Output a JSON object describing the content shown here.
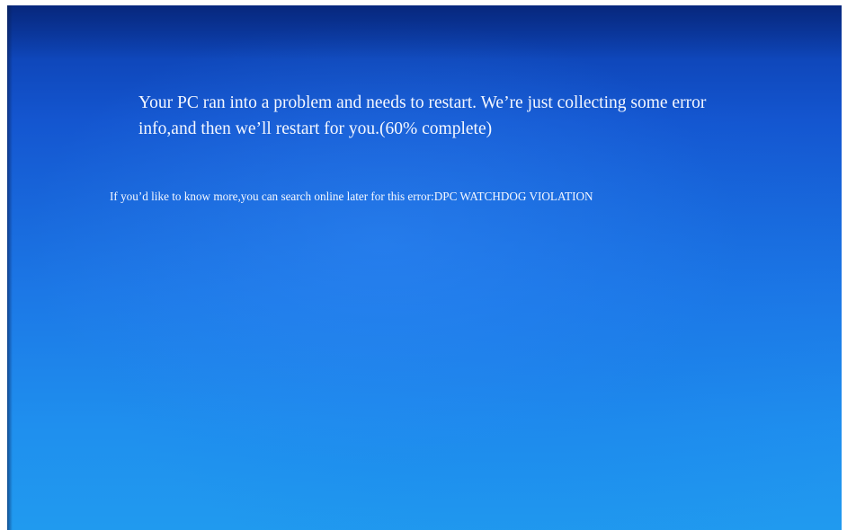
{
  "error_screen": {
    "message_line_1": "Your PC ran into a problem and needs to restart. We’re just collecting some error",
    "message_line_2": "info,and then we’ll restart for you.(60% complete)",
    "progress_percent": 60,
    "more_info": "If you’d like to know more,you can search online later for this error:DPC WATCHDOG VIOLATION",
    "stop_code": "DPC WATCHDOG VIOLATION"
  },
  "colors": {
    "background_top": "#0a3aa8",
    "background_bottom": "#209aef",
    "text": "#f4f7ff"
  }
}
